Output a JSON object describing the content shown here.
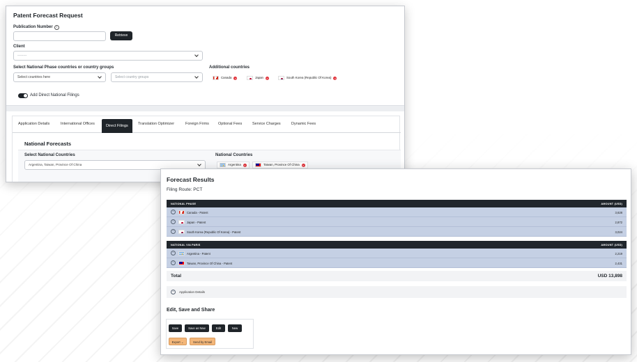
{
  "request": {
    "title": "Patent Forecast Request",
    "publication_label": "Publication Number",
    "info_icon": "i",
    "publication_value": "",
    "retrieve_label": "Retrieve",
    "client_label": "Client",
    "client_value": "--------",
    "np_label": "Select National Phase countries or country groups",
    "countries_placeholder": "Select countries here",
    "groups_placeholder": "Select country groups",
    "additional_label": "Additional countries",
    "additional": [
      {
        "name": "Canada",
        "flag": "ca"
      },
      {
        "name": "Japan",
        "flag": "jp"
      },
      {
        "name": "South Korea (Republic Of Korea)",
        "flag": "kr"
      }
    ],
    "toggle_label": "Add Direct National Filings",
    "tabs": [
      "Application Details",
      "International Offices",
      "Direct Filings",
      "Translation Optimizer",
      "Foreign Firms",
      "Optional Fees",
      "Service Charges",
      "Dynamic Fees"
    ],
    "active_tab": "Direct Filings",
    "national_title": "National Forecasts",
    "select_national_label": "Select National Countries",
    "select_national_value": "Argentina, Taiwan, Province Of China",
    "national_countries_label": "National Countries",
    "national": [
      {
        "name": "Argentina",
        "flag": "ar"
      },
      {
        "name": "Taiwan, Province Of China",
        "flag": "tw"
      }
    ],
    "remove_glyph": "×"
  },
  "results": {
    "title": "Forecast Results",
    "route": "Filing Route: PCT",
    "np_header": "NATIONAL PHASE",
    "np_amount_header": "AMOUNT (USD)",
    "np_rows": [
      {
        "name": "Canada - Patent",
        "amount": "3,628"
      },
      {
        "name": "Japan - Patent",
        "amount": "2,872"
      },
      {
        "name": "South Korea (Republic Of Korea) - Patent",
        "amount": "3,024"
      }
    ],
    "paris_header": "NATIONAL VIA PARIS",
    "paris_amount_header": "AMOUNT (USD)",
    "paris_rows": [
      {
        "name": "Argentina - Patent",
        "amount": "2,219"
      },
      {
        "name": "Taiwan, Province Of China - Patent",
        "amount": "2,431"
      }
    ],
    "total_label": "Total",
    "total_value": "USD 13,898",
    "app_details": "Application Details",
    "minus_glyph": "−",
    "esh_title": "Edit, Save and Share",
    "buttons": {
      "save": "Save",
      "save_new": "Save as New",
      "edit": "Edit",
      "new": "New",
      "export": "Export ⌄",
      "email": "Send by Email"
    }
  }
}
